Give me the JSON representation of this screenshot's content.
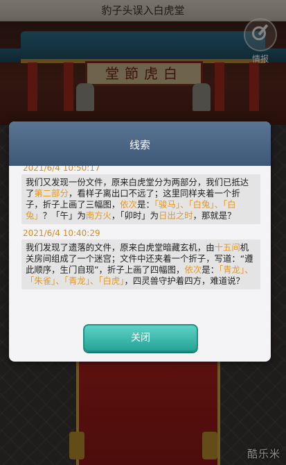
{
  "header": {
    "title": "豹子头误入白虎堂"
  },
  "scene": {
    "plaque_text": "堂節虎白"
  },
  "intel_button": {
    "label": "情报",
    "icon": "target-dart-icon"
  },
  "dialog": {
    "title": "线索",
    "close_label": "关闭",
    "entries": [
      {
        "time": "2021/6/4  10:50:17",
        "segments": [
          {
            "t": "我们又发现一份文件，原来白虎堂分为两部分，我们已抵达了",
            "hl": false
          },
          {
            "t": "第二部分",
            "hl": true
          },
          {
            "t": "，看样子离出口不远了；这里同样夹着一个折子，折子上画了三幅图，",
            "hl": false
          },
          {
            "t": "依次",
            "hl": true
          },
          {
            "t": "是：",
            "hl": false
          },
          {
            "t": "「骏马」、「白兔」、「白兔」",
            "hl": true
          },
          {
            "t": "？「午」为",
            "hl": false
          },
          {
            "t": "南方火",
            "hl": true
          },
          {
            "t": "，「卯时」为",
            "hl": false
          },
          {
            "t": "日出之时",
            "hl": true
          },
          {
            "t": "，那就是？",
            "hl": false
          }
        ]
      },
      {
        "time": "2021/6/4  10:40:29",
        "segments": [
          {
            "t": "我们发现了遗落的文件，原来白虎堂暗藏玄机，由",
            "hl": false
          },
          {
            "t": "十五间",
            "hl": true
          },
          {
            "t": "机关房间组成了一个迷宫；文件中还夹着一个折子，写道：“遵此顺序，生门自现”，折子上画了四幅图，",
            "hl": false
          },
          {
            "t": "依次",
            "hl": true
          },
          {
            "t": "是：",
            "hl": false
          },
          {
            "t": "「青龙」、「朱雀」、「青龙」、「白虎」",
            "hl": true
          },
          {
            "t": "，四灵兽守护着四方，难道说？",
            "hl": false
          }
        ]
      }
    ]
  },
  "watermark": "酷乐米",
  "colors": {
    "highlight": "#e8961c",
    "header_bg": "#4a6586",
    "button": "#3dbbad"
  }
}
